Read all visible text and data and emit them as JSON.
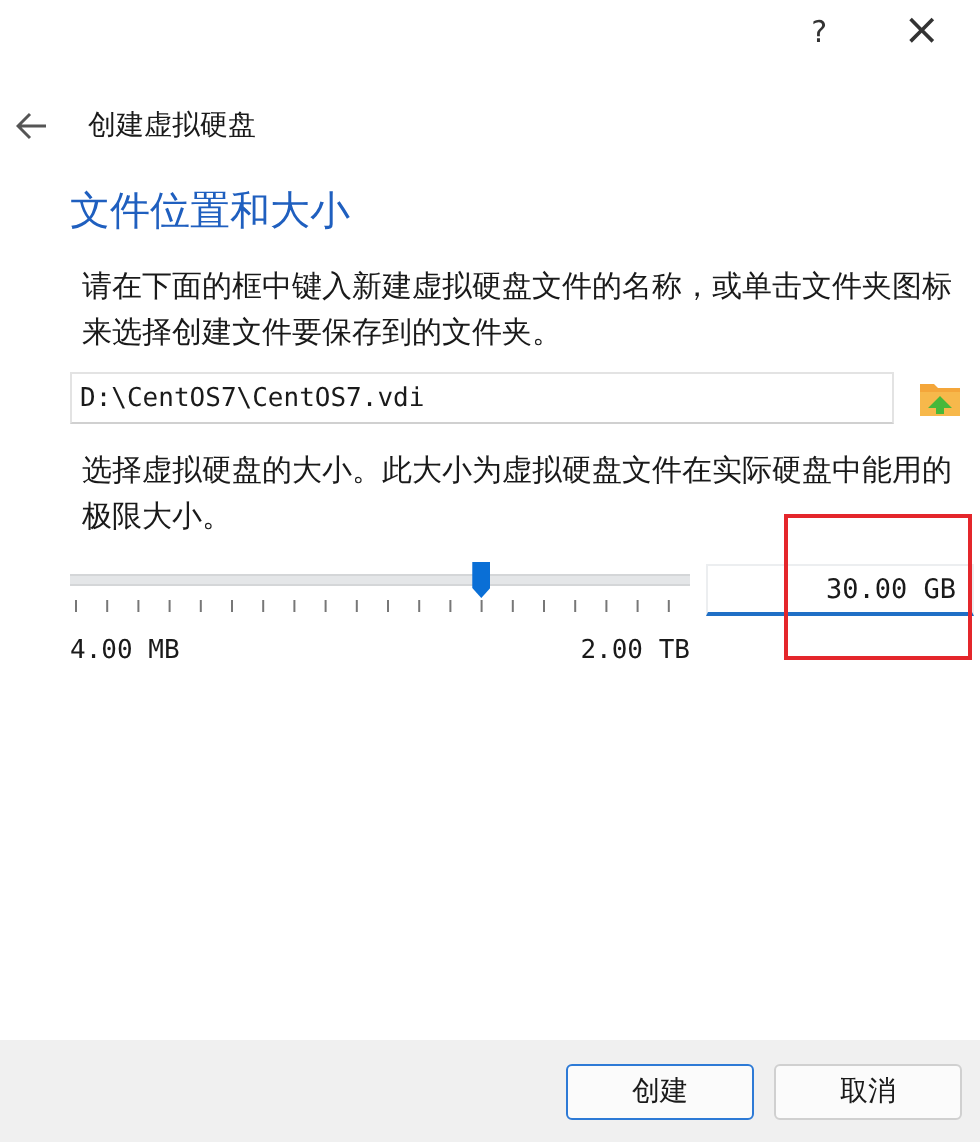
{
  "title_bar": {
    "help": "?",
    "close": "×"
  },
  "header": {
    "title": "创建虚拟硬盘"
  },
  "heading": "文件位置和大小",
  "location_text": "请在下面的框中键入新建虚拟硬盘文件的名称，或单击文件夹图标来选择创建文件要保存到的文件夹。",
  "path_field": {
    "value": "D:\\CentOS7\\CentOS7.vdi"
  },
  "size_text": "选择虚拟硬盘的大小。此大小为虚拟硬盘文件在实际硬盘中能用的极限大小。",
  "size_slider": {
    "level": 0.665,
    "min_label": "4.00 MB",
    "max_label": "2.00 TB"
  },
  "size_field": {
    "value": "30.00 GB",
    "highlighted": true
  },
  "buttons": [
    {
      "label": "创建",
      "kind": "default"
    },
    {
      "label": "取消",
      "kind": "normal"
    }
  ]
}
